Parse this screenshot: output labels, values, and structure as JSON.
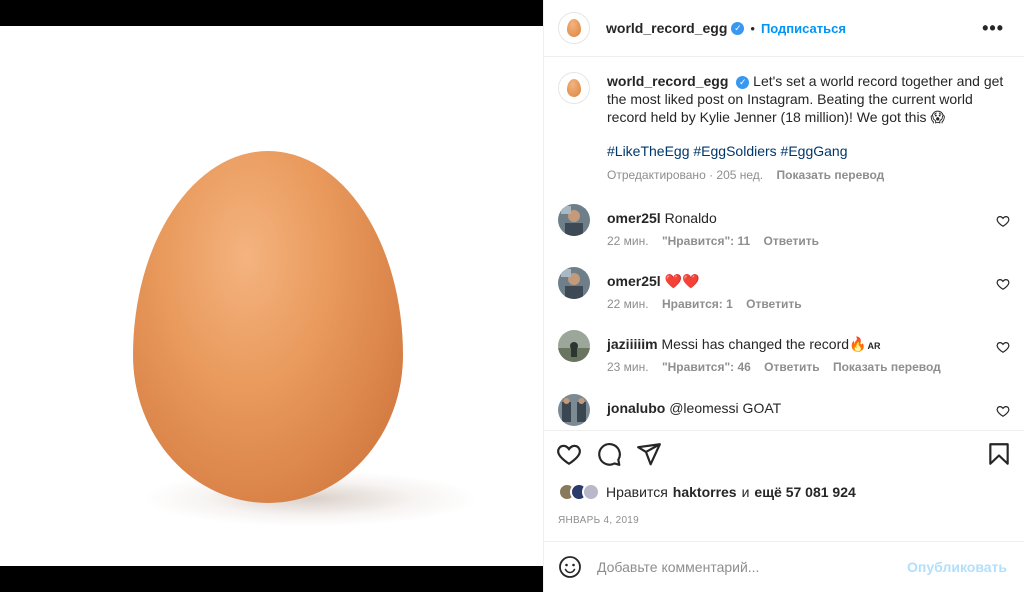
{
  "header": {
    "username": "world_record_egg",
    "separator": "•",
    "follow_label": "Подписаться",
    "more_label": "•••"
  },
  "caption": {
    "username": "world_record_egg",
    "text": "Let's set a world record together and get the most liked post on Instagram. Beating the current world record held by Kylie Jenner (18 million)! We got this 😱",
    "hashtags": "#LikeTheEgg #EggSoldiers #EggGang",
    "edited": "Отредактировано · 205 нед.",
    "translate": "Показать перевод"
  },
  "comments": [
    {
      "user": "omer25l",
      "text": "Ronaldo",
      "time": "22 мин.",
      "likes": "\"Нравится\": 11",
      "reply": "Ответить",
      "translate": ""
    },
    {
      "user": "omer25l",
      "text": "❤️❤️",
      "time": "22 мин.",
      "likes": "Нравится: 1",
      "reply": "Ответить",
      "translate": ""
    },
    {
      "user": "jaziiiiim",
      "text": "Messi has changed the record🔥",
      "time": "23 мин.",
      "likes": "\"Нравится\": 46",
      "reply": "Ответить",
      "translate": "Показать перевод"
    },
    {
      "user": "jonalubo",
      "text": "@leomessi GOAT",
      "time": "",
      "likes": "",
      "reply": "",
      "translate": ""
    }
  ],
  "comment_suffix_flag": "AR",
  "likes": {
    "prefix": "Нравится",
    "user": "haktorres",
    "connector": "и",
    "count": "ещё 57 081 924"
  },
  "date": "ЯНВАРЬ 4, 2019",
  "add_comment": {
    "placeholder": "Добавьте комментарий...",
    "post_label": "Опубликовать"
  },
  "icons": [
    "heart-icon",
    "comment-icon",
    "share-icon",
    "bookmark-icon",
    "emoji-icon",
    "verified-icon",
    "more-icon"
  ],
  "colors": {
    "accent": "#0095f6",
    "hashtag": "#00376b",
    "muted": "#8e8e8e",
    "post_disabled": "#b2dffc",
    "verified": "#3897f0"
  }
}
